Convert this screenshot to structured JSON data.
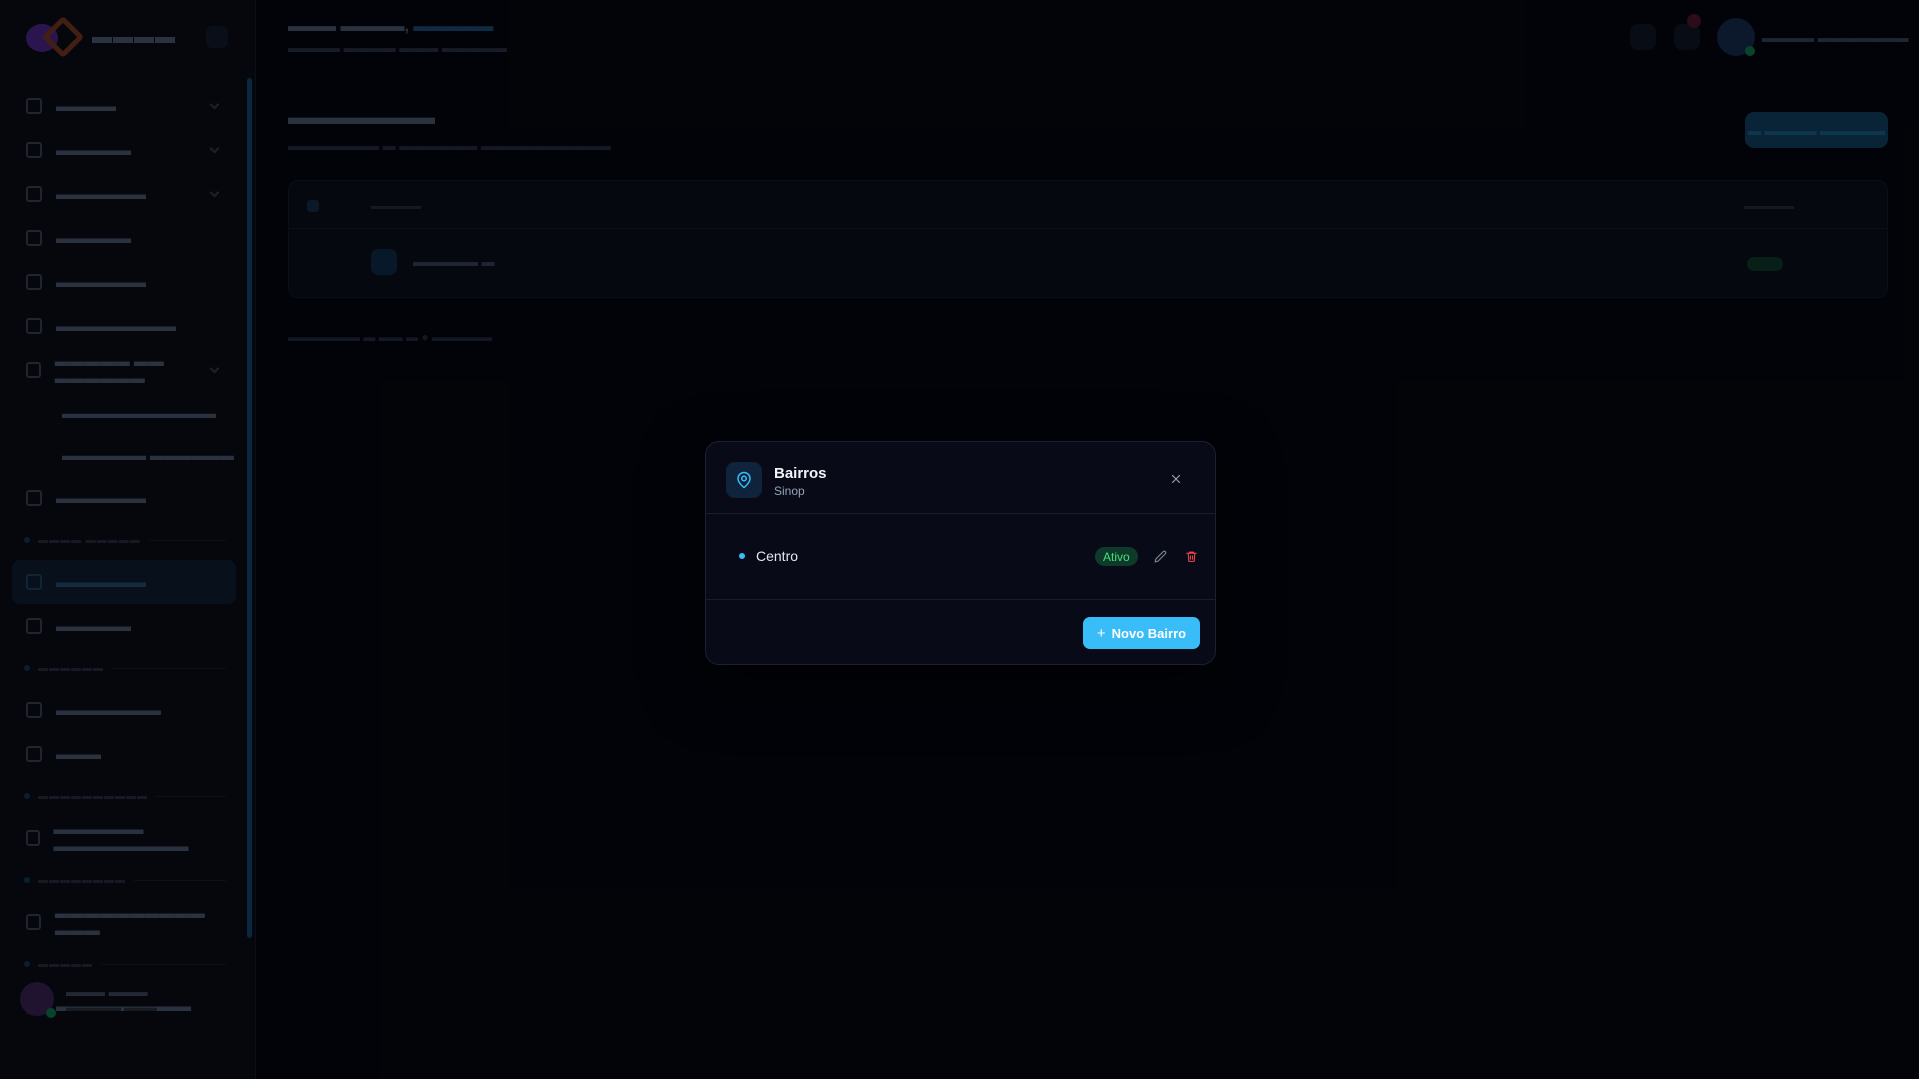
{
  "modal": {
    "title": "Bairros",
    "subtitle": "Sinop",
    "icon": "map-pin-icon",
    "close_icon": "close-icon",
    "items": [
      {
        "name": "Centro",
        "status": "Ativo"
      }
    ],
    "new_button_icon": "plus-icon",
    "new_button_label": "Novo Bairro"
  },
  "colors": {
    "accent": "#38bdf8",
    "status_active_text": "#4ade80",
    "status_active_bg": "#0e3a2a",
    "delete": "#ef4444",
    "modal_bg": "#080b17",
    "page_bg": "#03050b"
  }
}
